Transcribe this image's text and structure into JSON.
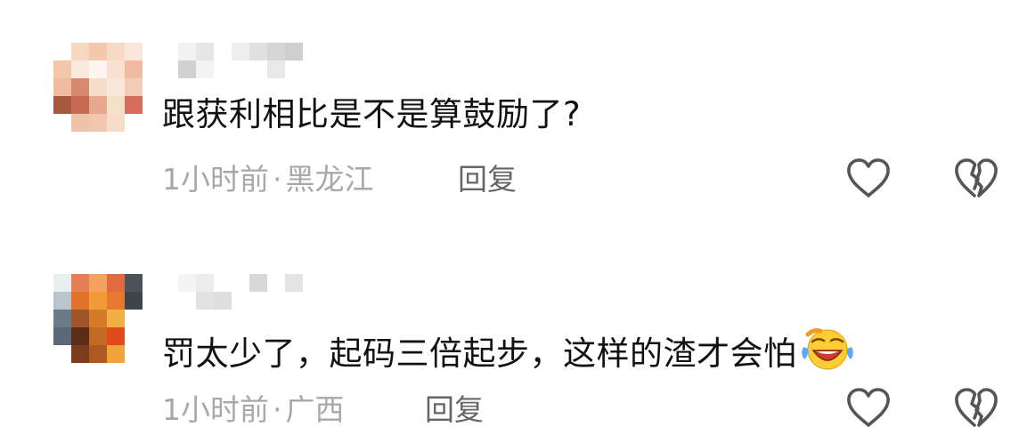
{
  "comments": [
    {
      "text": "跟获利相比是不是算鼓励了?",
      "time": "1小时前",
      "location": "黑龙江",
      "reply_label": "回复",
      "has_emoji": false
    },
    {
      "text": "罚太少了，起码三倍起步，这样的渣才会怕",
      "time": "1小时前",
      "location": "广西",
      "reply_label": "回复",
      "has_emoji": true
    }
  ],
  "meta_separator": "·",
  "icons": {
    "like": "heart-outline-icon",
    "dislike": "broken-heart-icon",
    "emoji": "face-tears-of-joy-emoji"
  },
  "colors": {
    "text": "#111111",
    "meta": "#a8a8a8",
    "reply": "#666666",
    "icon": "#555555"
  }
}
